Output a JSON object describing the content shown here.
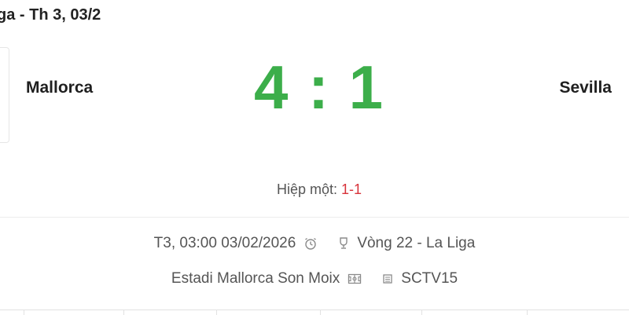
{
  "header": {
    "title": "ga - Th 3, 03/2"
  },
  "match": {
    "home_team": "Mallorca",
    "away_team": "Sevilla",
    "home_score": "4",
    "separator": ":",
    "away_score": "1",
    "halftime_label": "Hiệp một:",
    "halftime_score": "1-1"
  },
  "info": {
    "datetime": "T3, 03:00 03/02/2026",
    "round": "Vòng 22 - La Liga",
    "stadium": "Estadi Mallorca Son Moix",
    "channel": "SCTV15"
  },
  "icons": {
    "alarm": "alarm-clock-icon",
    "trophy": "trophy-icon",
    "stadium": "stadium-icon",
    "tv": "tv-icon"
  },
  "colors": {
    "score": "#3cae4a",
    "halftime_score": "#d8333b"
  }
}
